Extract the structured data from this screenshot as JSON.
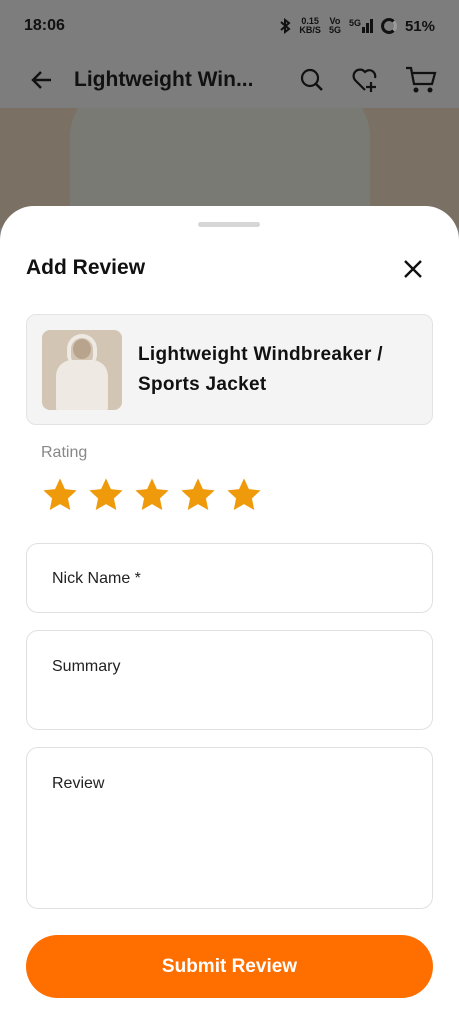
{
  "status_bar": {
    "time": "18:06",
    "network_speed": "0.15",
    "network_unit": "KB/S",
    "volte_top": "Vo",
    "volte_bottom": "5G",
    "signal_label": "5G",
    "battery": "51%"
  },
  "top_bar": {
    "title": "Lightweight Win..."
  },
  "sheet": {
    "title": "Add Review",
    "product_name": "Lightweight Windbreaker / Sports Jacket",
    "rating_label": "Rating",
    "rating": 5,
    "rating_max": 5,
    "star_color": "#ef9a0b",
    "fields": {
      "nick_name_placeholder": "Nick Name *",
      "summary_placeholder": "Summary",
      "review_placeholder": "Review"
    },
    "submit_label": "Submit Review",
    "accent_color": "#ff6f00"
  }
}
